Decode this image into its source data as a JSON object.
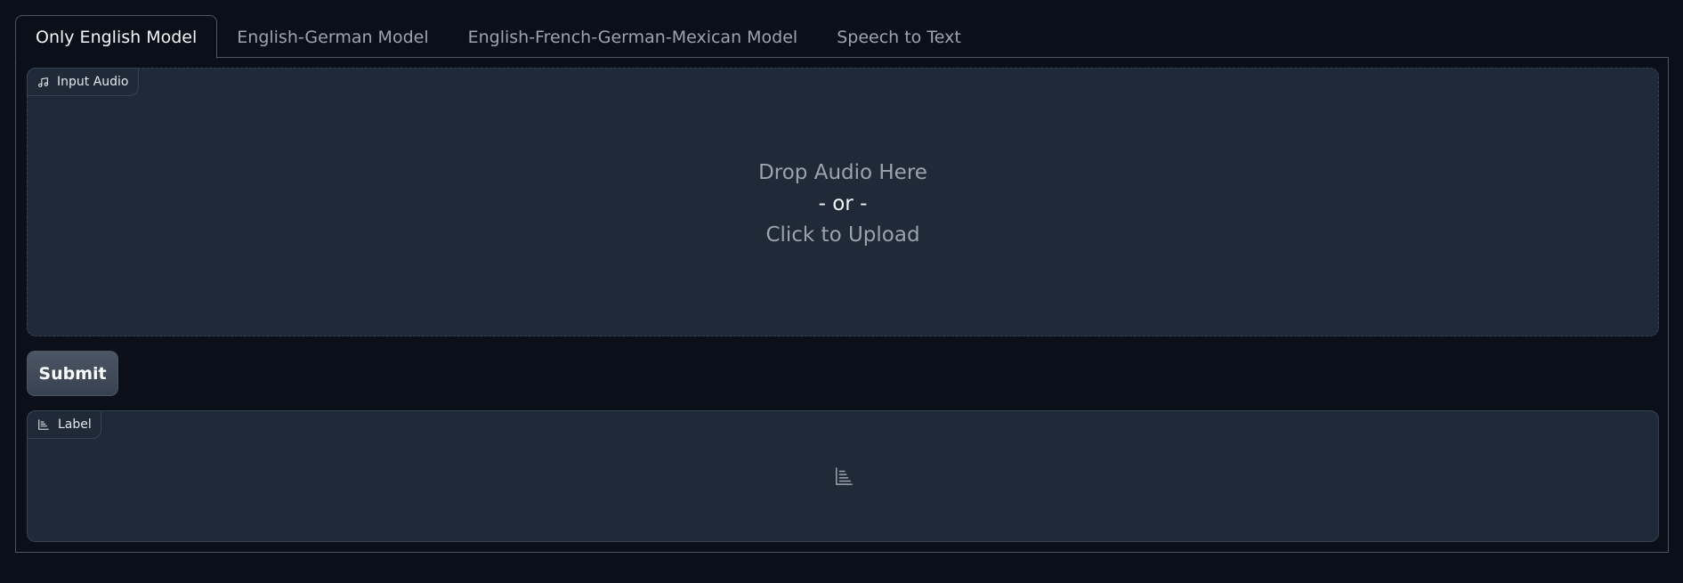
{
  "tabs": [
    {
      "label": "Only English Model",
      "active": true
    },
    {
      "label": "English-German Model",
      "active": false
    },
    {
      "label": "English-French-German-Mexican Model",
      "active": false
    },
    {
      "label": "Speech to Text",
      "active": false
    }
  ],
  "audio_input": {
    "label": "Input Audio",
    "icon": "music-icon",
    "drop_text": "Drop Audio Here",
    "or_text": "- or -",
    "upload_text": "Click to Upload"
  },
  "submit": {
    "label": "Submit"
  },
  "output": {
    "label": "Label",
    "icon": "chart-icon",
    "empty_icon": "chart-icon"
  },
  "colors": {
    "background": "#0b0f19",
    "block": "#1f2937",
    "border": "#374151",
    "muted_text": "#9ca3af"
  }
}
